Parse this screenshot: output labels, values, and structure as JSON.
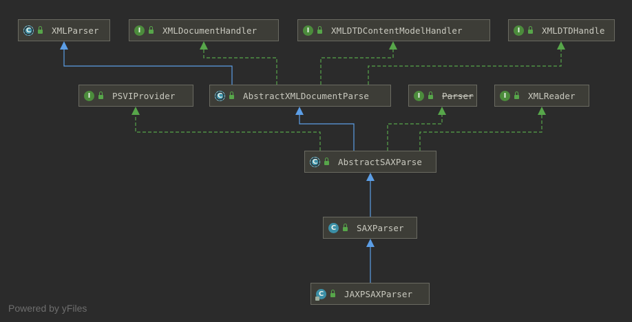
{
  "diagram": {
    "nodes": [
      {
        "id": "xmlparser",
        "label": "XMLParser",
        "kind": "abstract",
        "badge": "C",
        "icon": "abstract-class-icon"
      },
      {
        "id": "xmldocumenthandler",
        "label": "XMLDocumentHandler",
        "kind": "interface",
        "badge": "I",
        "icon": "interface-icon"
      },
      {
        "id": "xmldtdcontentmodelhandler",
        "label": "XMLDTDContentModelHandler",
        "kind": "interface",
        "badge": "I",
        "icon": "interface-icon"
      },
      {
        "id": "xmldtdhandler",
        "label": "XMLDTDHandle",
        "kind": "interface",
        "badge": "I",
        "icon": "interface-icon"
      },
      {
        "id": "psviprovider",
        "label": "PSVIProvider",
        "kind": "interface",
        "badge": "I",
        "icon": "interface-icon"
      },
      {
        "id": "abstractxmldocumentparser",
        "label": "AbstractXMLDocumentParse",
        "kind": "abstract",
        "badge": "C",
        "icon": "abstract-class-icon"
      },
      {
        "id": "parser",
        "label": "Parser",
        "kind": "interface",
        "badge": "I",
        "icon": "interface-icon",
        "deprecated": true
      },
      {
        "id": "xmlreader",
        "label": "XMLReader",
        "kind": "interface",
        "badge": "I",
        "icon": "interface-icon"
      },
      {
        "id": "abstractsaxparser",
        "label": "AbstractSAXParse",
        "kind": "abstract",
        "badge": "C",
        "icon": "abstract-class-icon"
      },
      {
        "id": "saxparser",
        "label": "SAXParser",
        "kind": "class",
        "badge": "C",
        "icon": "class-icon"
      },
      {
        "id": "jaxpsaxparser",
        "label": "JAXPSAXParser",
        "kind": "class",
        "badge": "C",
        "icon": "class-icon"
      }
    ],
    "edges": [
      {
        "from": "abstractxmldocumentparser",
        "to": "xmlparser",
        "type": "extends"
      },
      {
        "from": "abstractxmldocumentparser",
        "to": "xmldocumenthandler",
        "type": "implements"
      },
      {
        "from": "abstractxmldocumentparser",
        "to": "xmldtdcontentmodelhandler",
        "type": "implements"
      },
      {
        "from": "abstractxmldocumentparser",
        "to": "xmldtdhandler",
        "type": "implements"
      },
      {
        "from": "abstractsaxparser",
        "to": "psviprovider",
        "type": "implements"
      },
      {
        "from": "abstractsaxparser",
        "to": "abstractxmldocumentparser",
        "type": "extends"
      },
      {
        "from": "abstractsaxparser",
        "to": "parser",
        "type": "implements"
      },
      {
        "from": "abstractsaxparser",
        "to": "xmlreader",
        "type": "implements"
      },
      {
        "from": "saxparser",
        "to": "abstractsaxparser",
        "type": "extends"
      },
      {
        "from": "jaxpsaxparser",
        "to": "saxparser",
        "type": "extends"
      }
    ],
    "colors": {
      "background": "#2b2b2b",
      "node_fill": "#3d3d37",
      "node_border": "#6b6b62",
      "extends_edge": "#5c9ee6",
      "implements_edge": "#57a64a",
      "label_text": "#c9c9bf"
    }
  },
  "watermark": "Powered by yFiles"
}
